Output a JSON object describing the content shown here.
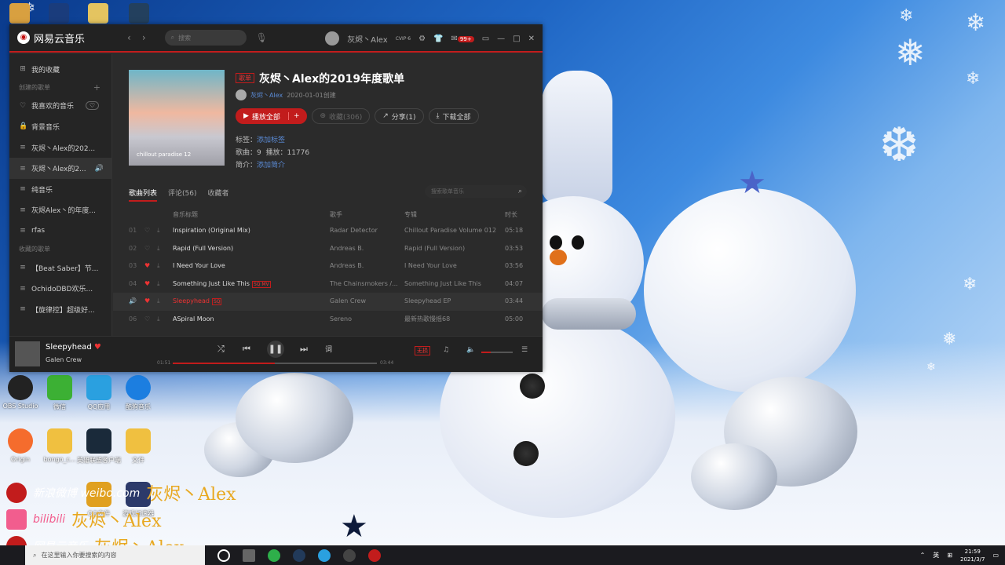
{
  "app": {
    "name": "网易云音乐",
    "search_placeholder": "搜索",
    "user_name": "灰烬丶Alex",
    "vip": "CVIP·6",
    "mail_badge": "99+"
  },
  "sidebar": {
    "my_collection": "我的收藏",
    "created_header": "创建的歌单",
    "created": [
      "我喜欢的音乐",
      "背景音乐",
      "灰烬丶Alex的202...",
      "灰烬丶Alex的2...",
      "纯音乐",
      "灰烬Alex丶的年度...",
      "rfas"
    ],
    "collected_header": "收藏的歌单",
    "collected": [
      "【Beat Saber】节...",
      "OchidoDBD欢乐...",
      "【旋律控】超级好..."
    ]
  },
  "playlist": {
    "type_tag": "歌单",
    "title": "灰烬丶Alex的2019年度歌单",
    "creator": "灰烬丶Alex",
    "created_date": "2020-01-01创建",
    "cover_text": "chillout paradise 12",
    "play_all": "播放全部",
    "collect": "收藏(306)",
    "share": "分享(1)",
    "download": "下载全部",
    "tags_label": "标签：",
    "tags_link": "添加标签",
    "songs_label": "歌曲：9",
    "plays_label": "播放：11776",
    "intro_label": "简介：",
    "intro_link": "添加简介",
    "tabs": [
      "歌曲列表",
      "评论(56)",
      "收藏者"
    ],
    "search_placeholder": "搜索歌单音乐"
  },
  "table": {
    "headers": [
      "音乐标题",
      "歌手",
      "专辑",
      "时长"
    ],
    "rows": [
      {
        "idx": "01",
        "title": "Inspiration (Original Mix)",
        "artist": "Radar Detector",
        "album": "Chillout Paradise Volume 012",
        "duration": "05:18",
        "liked": false,
        "tags": ""
      },
      {
        "idx": "02",
        "title": "Rapid (Full Version)",
        "artist": "Andreas B.",
        "album": "Rapid (Full Version)",
        "duration": "03:53",
        "liked": false,
        "tags": ""
      },
      {
        "idx": "03",
        "title": "I Need Your Love",
        "artist": "Andreas B.",
        "album": "I Need Your Love",
        "duration": "03:56",
        "liked": true,
        "tags": ""
      },
      {
        "idx": "04",
        "title": "Something Just Like This",
        "artist": "The Chainsmokers /...",
        "album": "Something Just Like This",
        "duration": "04:07",
        "liked": true,
        "tags": "SQ MV"
      },
      {
        "idx": "",
        "title": "Sleepyhead",
        "artist": "Galen Crew",
        "album": "Sleepyhead EP",
        "duration": "03:44",
        "liked": true,
        "tags": "SQ"
      },
      {
        "idx": "06",
        "title": "ASpiral Moon",
        "artist": "Sereno",
        "album": "最新热歌慢摇68",
        "duration": "05:00",
        "liked": false,
        "tags": ""
      }
    ]
  },
  "player": {
    "title": "Sleepyhead",
    "artist": "Galen Crew",
    "elapsed": "01:51",
    "total": "03:44",
    "progress": 0.5,
    "volume": 0.3,
    "lyric": "词",
    "quality": "无损"
  },
  "desktop": {
    "icons_row1": [
      "OBS Studio",
      "微信",
      "QQ应用",
      "酷狗音乐"
    ],
    "icons_row2": [
      "Origin",
      "bongo_c...",
      "英雄联盟客户端",
      "文件"
    ],
    "icons_row3": [
      "",
      "",
      "QQ文件",
      "游戏加速器"
    ],
    "watermark_text": "灰烬丶Alex",
    "weibo": "新浪微博 weibo.com",
    "bili": "bilibili",
    "netease_label": "网易云音乐"
  },
  "taskbar": {
    "search": "在这里输入你要搜索的内容",
    "lang": "英",
    "time": "21:59",
    "date": "2021/3/7"
  }
}
